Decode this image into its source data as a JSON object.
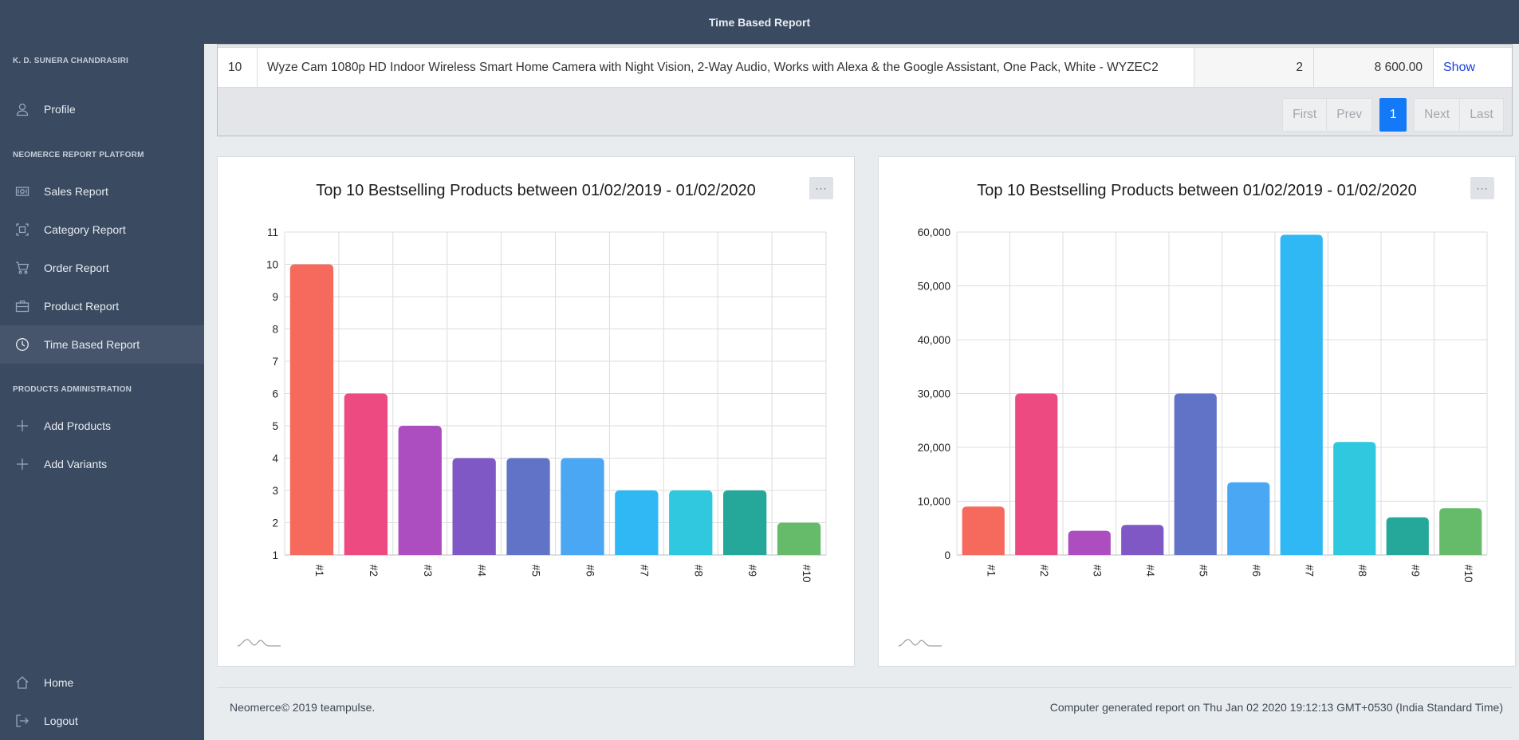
{
  "header": {
    "title": "Time Based Report"
  },
  "sidebar": {
    "user": "K. D. SUNERA CHANDRASIRI",
    "profile": {
      "label": "Profile",
      "icon": "user-icon"
    },
    "section_platform": "NEOMERCE REPORT PLATFORM",
    "platform_items": [
      {
        "label": "Sales Report",
        "icon": "money-icon"
      },
      {
        "label": "Category Report",
        "icon": "grid-frame-icon"
      },
      {
        "label": "Order Report",
        "icon": "cart-icon"
      },
      {
        "label": "Product Report",
        "icon": "briefcase-icon"
      },
      {
        "label": "Time Based Report",
        "icon": "clock-icon",
        "active": true
      }
    ],
    "section_admin": "PRODUCTS ADMINISTRATION",
    "admin_items": [
      {
        "label": "Add Products",
        "icon": "plus-icon"
      },
      {
        "label": "Add Variants",
        "icon": "plus-icon"
      }
    ],
    "home": {
      "label": "Home",
      "icon": "home-icon"
    },
    "logout": {
      "label": "Logout",
      "icon": "logout-icon"
    }
  },
  "table": {
    "row": {
      "rank": "10",
      "product": "Wyze Cam 1080p HD Indoor Wireless Smart Home Camera with Night Vision, 2-Way Audio, Works with Alexa & the Google Assistant, One Pack, White - WYZEC2",
      "quantity": "2",
      "amount": "8 600.00",
      "action": "Show"
    }
  },
  "pagination": {
    "first": "First",
    "prev": "Prev",
    "current": "1",
    "next": "Next",
    "last": "Last"
  },
  "charts": {
    "left_title": "Top 10 Bestselling Products between 01/02/2019 - 01/02/2020",
    "right_title": "Top 10 Bestselling Products between 01/02/2019 - 01/02/2020",
    "menu_label": "···"
  },
  "chart_data": [
    {
      "type": "bar",
      "title": "Top 10 Bestselling Products between 01/02/2019 - 01/02/2020",
      "categories": [
        "#1",
        "#2",
        "#3",
        "#4",
        "#5",
        "#6",
        "#7",
        "#8",
        "#9",
        "#10"
      ],
      "values": [
        10,
        6,
        5,
        4,
        4,
        4,
        3,
        3,
        3,
        2
      ],
      "ylim": [
        1,
        11
      ],
      "yticks": [
        "1",
        "2",
        "3",
        "4",
        "5",
        "6",
        "7",
        "8",
        "9",
        "10",
        "11"
      ],
      "grid": true,
      "colors": [
        "#f56a5d",
        "#ec4a80",
        "#ac4ec0",
        "#7f58c6",
        "#6173c6",
        "#4aa7f4",
        "#30b8f5",
        "#2fc8de",
        "#25a899",
        "#66bb6a"
      ]
    },
    {
      "type": "bar",
      "title": "Top 10 Bestselling Products between 01/02/2019 - 01/02/2020",
      "categories": [
        "#1",
        "#2",
        "#3",
        "#4",
        "#5",
        "#6",
        "#7",
        "#8",
        "#9",
        "#10"
      ],
      "values": [
        9000,
        30000,
        4500,
        5600,
        30000,
        13500,
        59500,
        21000,
        7000,
        8700
      ],
      "ylim": [
        0,
        60000
      ],
      "yticks": [
        "0",
        "10,000",
        "20,000",
        "30,000",
        "40,000",
        "50,000",
        "60,000"
      ],
      "grid": true,
      "colors": [
        "#f56a5d",
        "#ec4a80",
        "#ac4ec0",
        "#7f58c6",
        "#6173c6",
        "#4aa7f4",
        "#30b8f5",
        "#2fc8de",
        "#25a899",
        "#66bb6a"
      ]
    }
  ],
  "footer": {
    "left": "Neomerce© 2019 teampulse.",
    "right": "Computer generated report on Thu Jan 02 2020 19:12:13 GMT+0530 (India Standard Time)"
  }
}
